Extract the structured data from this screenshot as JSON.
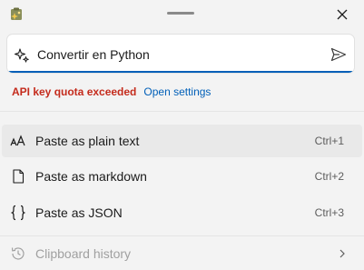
{
  "titlebar": {
    "app_icon": "advanced-paste-app-icon",
    "close_icon": "close-icon"
  },
  "prompt": {
    "value": "Convertir en Python",
    "left_icon": "sparkle-icon",
    "send_icon": "send-icon",
    "accent_color": "#005fb8"
  },
  "status": {
    "error_text": "API key quota exceeded",
    "error_color": "#c42b1c",
    "settings_link": "Open settings"
  },
  "menu": {
    "items": [
      {
        "label": "Paste as plain text",
        "shortcut": "Ctrl+1",
        "icon": "font-size-icon"
      },
      {
        "label": "Paste as markdown",
        "shortcut": "Ctrl+2",
        "icon": "document-icon"
      },
      {
        "label": "Paste as JSON",
        "shortcut": "Ctrl+3",
        "icon": "braces-icon"
      }
    ]
  },
  "history": {
    "label": "Clipboard history",
    "icon": "history-icon",
    "chevron_icon": "chevron-right-icon"
  }
}
